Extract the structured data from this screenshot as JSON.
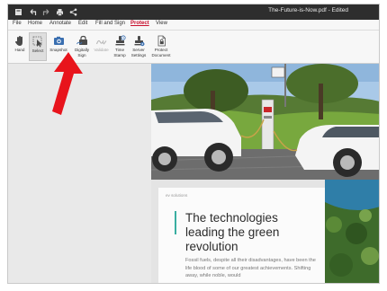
{
  "titlebar": {
    "title": "The-Future-is-Now.pdf - Edited",
    "icons": [
      "app-menu-icon",
      "undo-icon",
      "redo-icon",
      "print-icon",
      "share-icon"
    ]
  },
  "menu": {
    "items": [
      "File",
      "Home",
      "Annotate",
      "Edit",
      "Fill and Sign",
      "Protect",
      "View"
    ],
    "active": "Protect"
  },
  "ribbon": {
    "hand": "Hand",
    "select": "Select",
    "snapshot": "Snapshot",
    "digitally_sign": [
      "Digitally",
      "Sign"
    ],
    "validate": "Validate",
    "time_stamp": [
      "Time",
      "Stamp"
    ],
    "server_settings": [
      "Server",
      "Settings"
    ],
    "protect_document": [
      "Protect",
      "Document"
    ]
  },
  "article": {
    "brand": "ev solutions",
    "headline": "The technologies leading the green revolution",
    "body": "Fossil fuels, despite all their disadvantages, have been the life blood of some of our greatest achievements. Shifting away, while noble, would"
  },
  "colors": {
    "accent_menu": "#c8102e",
    "arrow": "#e8141c",
    "headline_bar": "#3aaea1"
  }
}
